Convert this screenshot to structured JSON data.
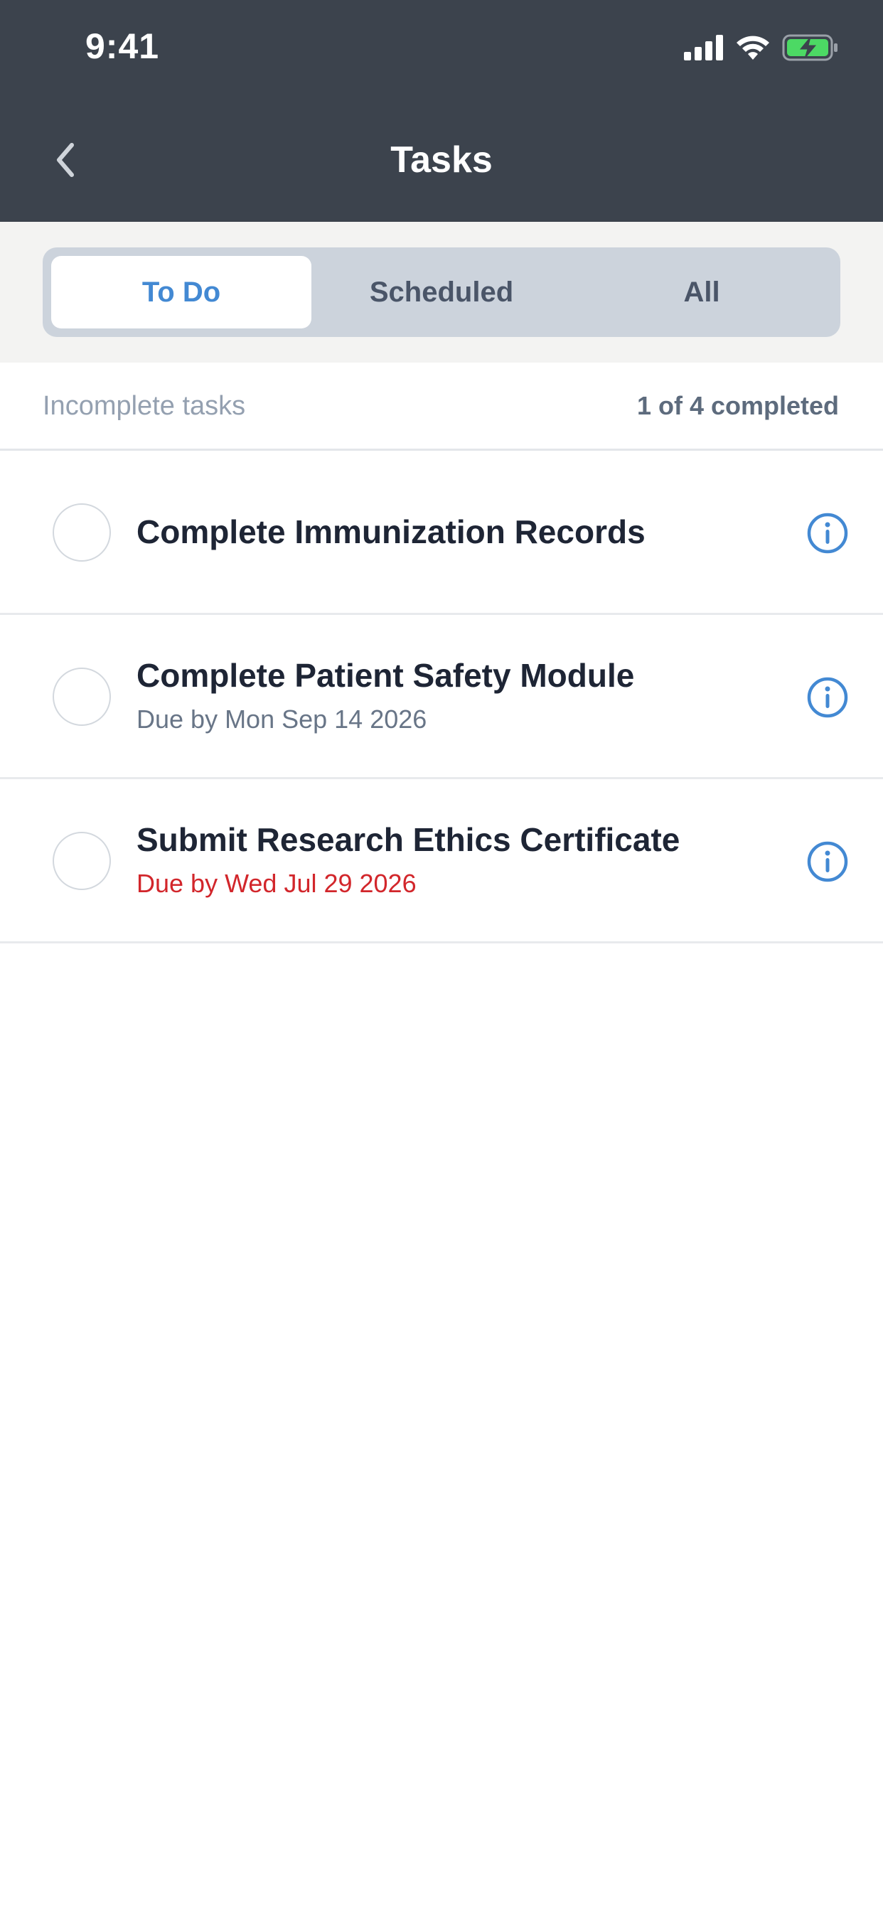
{
  "status_bar": {
    "time": "9:41"
  },
  "header": {
    "title": "Tasks",
    "back_icon": "chevron-left-icon"
  },
  "tabs": [
    {
      "label": "To Do",
      "active": true
    },
    {
      "label": "Scheduled",
      "active": false
    },
    {
      "label": "All",
      "active": false
    }
  ],
  "summary": {
    "label": "Incomplete tasks",
    "progress": "1 of 4 completed"
  },
  "tasks": [
    {
      "title": "Complete Immunization Records",
      "due": "",
      "overdue": false,
      "completed": false
    },
    {
      "title": "Complete Patient Safety Module",
      "due": "Due by Mon Sep 14 2026",
      "overdue": false,
      "completed": false
    },
    {
      "title": "Submit Research Ethics Certificate",
      "due": "Due by Wed Jul 29 2026",
      "overdue": true,
      "completed": false
    }
  ],
  "colors": {
    "header_bg": "#3c434d",
    "accent": "#4389d3",
    "overdue": "#d2262b",
    "battery_green": "#4cd964"
  },
  "icons": {
    "signal": "cellular-signal-icon",
    "wifi": "wifi-icon",
    "battery": "battery-charging-icon",
    "info": "info-circle-icon"
  }
}
